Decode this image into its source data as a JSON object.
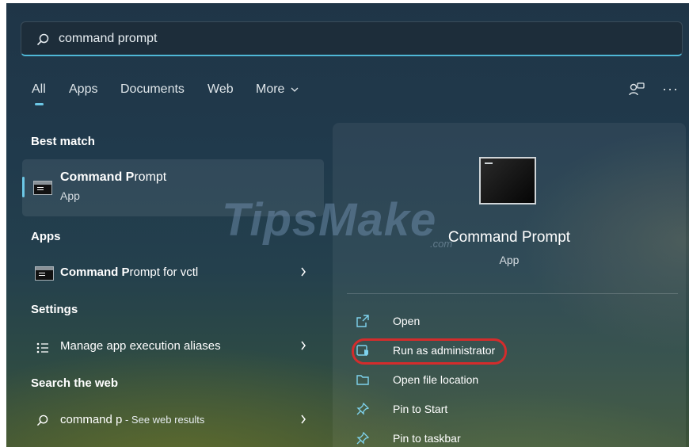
{
  "search": {
    "query_bold": "command p",
    "query_rest": "rompt"
  },
  "tabs": [
    "All",
    "Apps",
    "Documents",
    "Web",
    "More"
  ],
  "sections": {
    "best_match": "Best match",
    "apps": "Apps",
    "settings": "Settings",
    "search_web": "Search the web"
  },
  "best_match": {
    "title_bold": "Command P",
    "title_rest": "rompt",
    "subtitle": "App"
  },
  "apps": [
    {
      "bold": "Command P",
      "rest": "rompt for vctl"
    }
  ],
  "settings_items": [
    {
      "label": "Manage app execution aliases"
    }
  ],
  "web": {
    "query_bold": "command p",
    "suffix": " - See web results"
  },
  "detail": {
    "title": "Command Prompt",
    "subtitle": "App",
    "actions": [
      "Open",
      "Run as administrator",
      "Open file location",
      "Pin to Start",
      "Pin to taskbar"
    ]
  },
  "watermark": {
    "main": "TipsMake",
    "sub": ".com"
  },
  "colors": {
    "accent": "#6cc7e6",
    "highlight_circle": "#d42c2c"
  }
}
